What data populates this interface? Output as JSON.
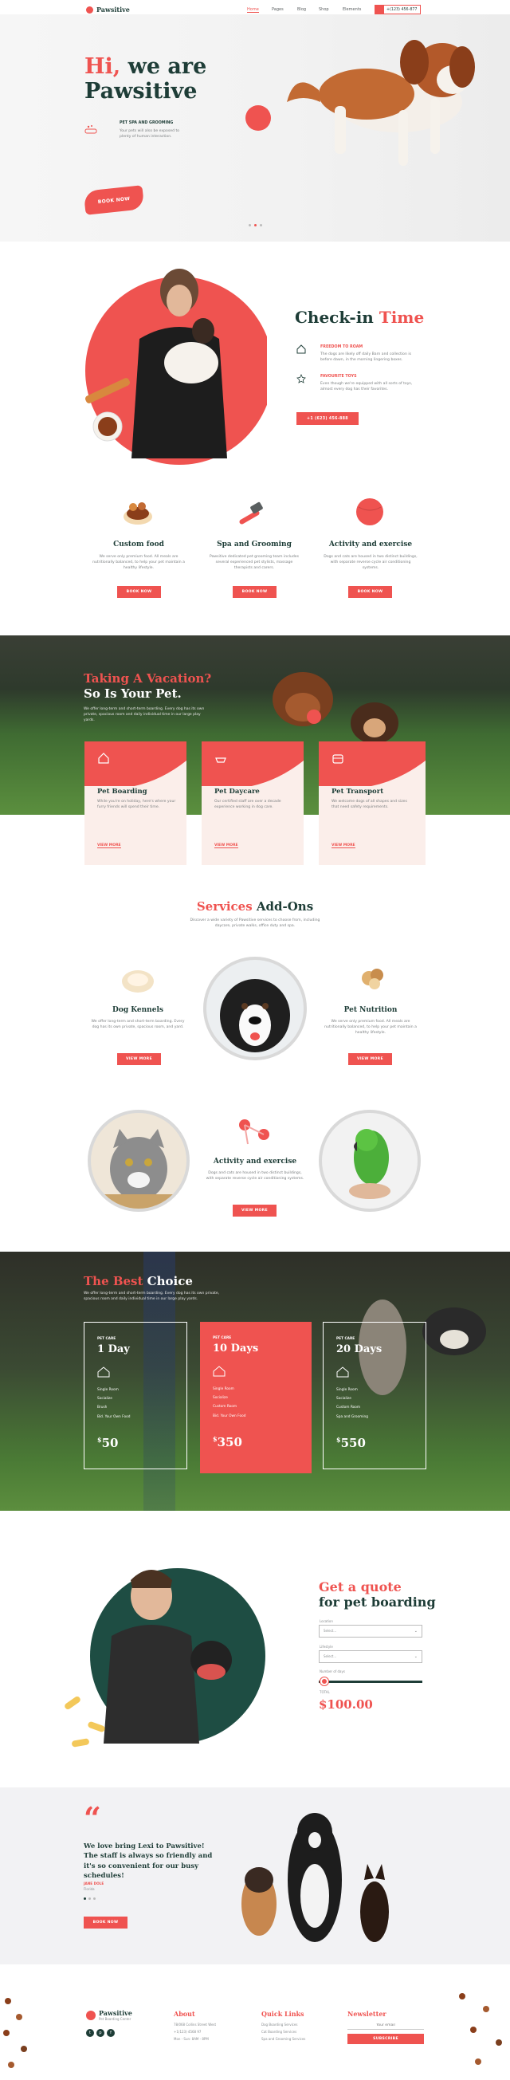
{
  "nav": {
    "logo": "Pawsitive",
    "links": [
      "Home",
      "Pages",
      "Blog",
      "Shop",
      "Elements"
    ],
    "phone": "+(123) 456-877"
  },
  "hero": {
    "title_1": "Hi,",
    "title_2": "we are",
    "title_3": "Pawsitive",
    "feature_title": "PET SPA AND GROOMING",
    "feature_text": "Your pets will also be exposed to plenty of human interaction.",
    "button": "BOOK NOW"
  },
  "checkin": {
    "title_1": "Check-in",
    "title_2": "Time",
    "items": [
      {
        "title": "FREEDOM TO ROAM",
        "text": "The dogs are likely off daily Barn and collection is before dawn, in the morning lingering boxes."
      },
      {
        "title": "FAVOURITE TOYS",
        "text": "Even though we're equipped with all sorts of toys, almost every dog has their favorites."
      }
    ],
    "button": "+1 (623) 456-888"
  },
  "services": [
    {
      "title": "Custom food",
      "text": "We serve only premium food. All meals are nutritionally balanced, to help your pet maintain a healthy lifestyle.",
      "button": "BOOK NOW"
    },
    {
      "title": "Spa and Grooming",
      "text": "Pawsitive dedicated pet grooming team includes several experienced pet stylists, massage therapists and carers.",
      "button": "BOOK NOW"
    },
    {
      "title": "Activity and exercise",
      "text": "Dogs and cats are housed in two distinct buildings, with separate reverse cycle air conditioning systems.",
      "button": "BOOK NOW"
    }
  ],
  "vacation": {
    "title_1": "Taking A Vacation?",
    "title_2": "So Is Your Pet.",
    "text": "We offer long-term and short-term boarding. Every dog has its own private, spacious room and daily individual time in our large play yards.",
    "cards": [
      {
        "title": "Pet Boarding",
        "text": "While you're on holiday, here's where your furry friends will spend their time.",
        "link": "VIEW MORE"
      },
      {
        "title": "Pet Daycare",
        "text": "Our certified staff are over a decade experience working in dog care.",
        "link": "VIEW MORE"
      },
      {
        "title": "Pet Transport",
        "text": "We welcome dogs of all shapes and sizes that need safety requirements.",
        "link": "VIEW MORE"
      }
    ]
  },
  "addons": {
    "title_1": "Services",
    "title_2": "Add-Ons",
    "text": "Discover a wide variety of Pawsitive services to choose from, including daycare, private walks, office duty and spa.",
    "items": [
      {
        "title": "Dog Kennels",
        "text": "We offer long-term and short-term boarding. Every dog has its own private, spacious room, and yard.",
        "button": "VIEW MORE"
      },
      {
        "title": "Pet Nutrition",
        "text": "We serve only premium food. All meals are nutritionally balanced, to help your pet maintain a healthy lifestyle.",
        "button": "VIEW MORE"
      },
      {
        "title": "Activity and exercise",
        "text": "Dogs and cats are housed in two distinct buildings, with separate reverse cycle air conditioning systems.",
        "button": "VIEW MORE"
      }
    ]
  },
  "pricing": {
    "title_1": "The Best",
    "title_2": "Choice",
    "text": "We offer long-term and short-term boarding. Every dog has its own private, spacious room and daily individual time in our large play yards.",
    "plans": [
      {
        "tag": "PET CARE",
        "period": "1 Day",
        "features": [
          "Single Room",
          "Socialize",
          "Brush",
          "Bid. Your Own Food"
        ],
        "price": "50",
        "currency": "$"
      },
      {
        "tag": "PET CARE",
        "period": "10 Days",
        "features": [
          "Single Room",
          "Socialize",
          "Custom Room",
          "Bid. Your Own Food"
        ],
        "price": "350",
        "currency": "$"
      },
      {
        "tag": "PET CARE",
        "period": "20 Days",
        "features": [
          "Single Room",
          "Socialize",
          "Custom Room",
          "Spa and Grooming"
        ],
        "price": "550",
        "currency": "$"
      }
    ]
  },
  "quote": {
    "title_1": "Get a quote",
    "title_2": "for pet boarding",
    "label_1": "Location",
    "select_1": "Select...",
    "label_2": "Lifestyle",
    "select_2": "Select...",
    "label_3": "Number of days",
    "total_label": "TOTAL",
    "total": "$100.00",
    "slider_value": 0.05
  },
  "testimonial": {
    "quote_mark": "“",
    "text": "We love bring Lexi to Pawsitive! The staff is always so friendly and it's so convenient for our busy schedules!",
    "author": "JANE DOLE",
    "role": "Florida",
    "button": "BOOK NOW"
  },
  "footer": {
    "logo": "Pawsitive",
    "tagline": "Pet Boarding Center",
    "about_title": "About",
    "about_items": [
      "78/068 Collins Street West",
      "+1(123) 4568 97",
      "Mon - Sun: 8AM - 8PM"
    ],
    "links_title": "Quick Links",
    "links": [
      "Dog Boarding Services",
      "Cat Boarding Services",
      "Spa and Grooming Services"
    ],
    "news_title": "Newsletter",
    "news_placeholder": "Your email",
    "news_button": "SUBSCRIBE"
  },
  "colors": {
    "accent": "#ef5350",
    "dark": "#1e3d37",
    "cream": "#fbeeea"
  }
}
